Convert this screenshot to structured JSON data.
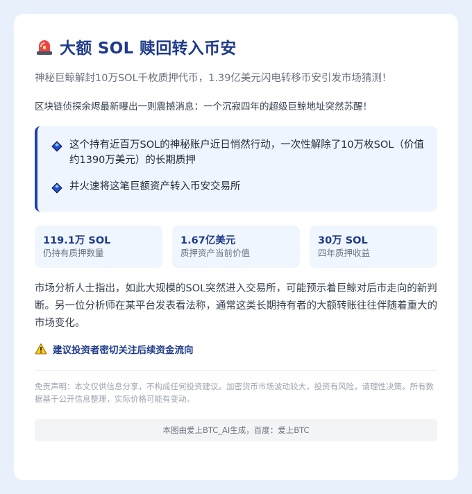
{
  "header": {
    "title": "大额 SOL 赎回转入币安",
    "subtitle": "神秘巨鲸解封10万SOL千枚质押代币，1.39亿美元闪电转移币安引发市场猜测！"
  },
  "intro": "区块链侦探余烬最新曝出一则震撼消息：一个沉寂四年的超级巨鲸地址突然苏醒！",
  "highlights": [
    {
      "text": "这个持有近百万SOL的神秘账户近日悄然行动，一次性解除了10万枚SOL（价值约1390万美元）的长期质押"
    },
    {
      "text": "并火速将这笔巨额资产转入币安交易所"
    }
  ],
  "stats": [
    {
      "value": "119.1万 SOL",
      "label": "仍持有质押数量"
    },
    {
      "value": "1.67亿美元",
      "label": "质押资产当前价值"
    },
    {
      "value": "30万 SOL",
      "label": "四年质押收益"
    }
  ],
  "analysis": "市场分析人士指出，如此大规模的SOL突然进入交易所，可能预示着巨鲸对后市走向的新判断。另一位分析师在某平台发表看法称，通常这类长期持有者的大额转账往往伴随着重大的市场变化。",
  "advice": "建议投资者密切关注后续资金流向",
  "disclaimer": "免责声明：本文仅供信息分享，不构成任何投资建议。加密货币市场波动较大，投资有风险，请理性决策。所有数据基于公开信息整理，实际价格可能有变动。",
  "footer": "本图由爱上BTC_AI生成，百度：爱上BTC",
  "colors": {
    "background": "#e8f1fb",
    "accent": "#1e3a8a",
    "highlight_bg": "#eef5fe",
    "stat_bg": "#f0f6fd"
  },
  "icons": {
    "title": "siren-icon",
    "bullet": "blue-diamond-icon",
    "advice": "warning-icon"
  }
}
